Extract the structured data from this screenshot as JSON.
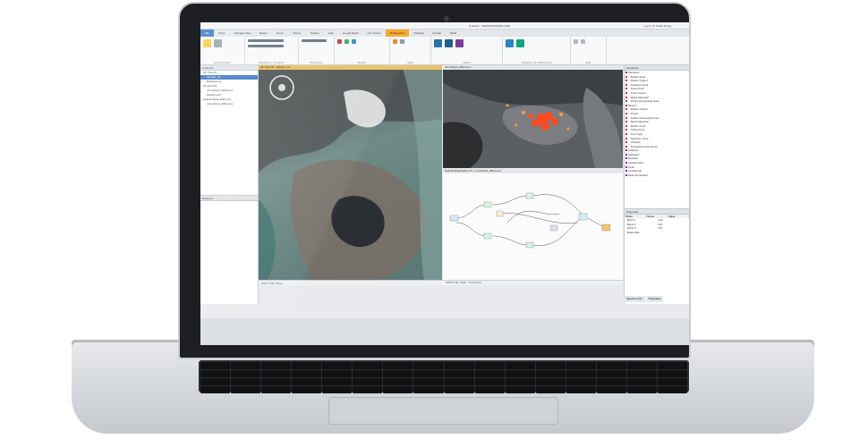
{
  "app": {
    "title": "Untitled1 - ERDAS IMAGINE 2018",
    "user": "Log in To Smart M.App"
  },
  "tabs": [
    {
      "label": "File"
    },
    {
      "label": "Home"
    },
    {
      "label": "Manage Data"
    },
    {
      "label": "Raster"
    },
    {
      "label": "Vector"
    },
    {
      "label": "Terrain"
    },
    {
      "label": "Toolbox"
    },
    {
      "label": "Help"
    },
    {
      "label": "Google Earth"
    },
    {
      "label": "UV Vectors"
    },
    {
      "label": "Multispectral"
    },
    {
      "label": "Drawing"
    },
    {
      "label": "Format"
    },
    {
      "label": "Table"
    }
  ],
  "context_tab": "Raster",
  "ribbon_groups": [
    {
      "label": "Enhancement"
    },
    {
      "label": "Brightness / Contrast"
    },
    {
      "label": "Sharpness"
    },
    {
      "label": "Bands"
    },
    {
      "label": "View"
    },
    {
      "label": "Utilities"
    },
    {
      "label": "Transform & Orthocorrect"
    },
    {
      "label": "Edit"
    }
  ],
  "contents": {
    "title": "Contents",
    "items": [
      {
        "label": "2D View #1"
      },
      {
        "label": "deurpel_12..."
      },
      {
        "label": "Background"
      },
      {
        "label": "2D View #2"
      },
      {
        "label": "normalized_difference"
      },
      {
        "label": "Background"
      },
      {
        "label": "Spatial Model Editor #1"
      },
      {
        "label": "normalized_difference"
      }
    ]
  },
  "retriever": {
    "title": "Retriever"
  },
  "views": {
    "left_title": "2D View #1 : deurpel_12...",
    "right_title": "normalized_difference",
    "model_title": "Spatial Model Editor #1 : normalized_difference"
  },
  "status": {
    "left": "479777.69, 6702...",
    "right": "479777.69, 6702... UTM Zone"
  },
  "operators": {
    "title": "Operators",
    "items": [
      {
        "label": "Favorites",
        "cat": true
      },
      {
        "label": "Raster Input"
      },
      {
        "label": "Raster Output"
      },
      {
        "label": "Features Input"
      },
      {
        "label": "Point Input"
      },
      {
        "label": "Point Output"
      },
      {
        "label": "Band Selection"
      },
      {
        "label": "Define Processing Area"
      },
      {
        "label": "Recent",
        "cat": true
      },
      {
        "label": "Raster Output"
      },
      {
        "label": "Pixels"
      },
      {
        "label": "Define Processing Area"
      },
      {
        "label": "Band Selection"
      },
      {
        "label": "Raster Input"
      },
      {
        "label": "String Input"
      },
      {
        "label": "Port Input"
      },
      {
        "label": "Directory Input"
      },
      {
        "label": "Preview"
      },
      {
        "label": "Principal Components"
      },
      {
        "label": "Analysis",
        "cat": true
      },
      {
        "label": "Attributes",
        "cat": true
      },
      {
        "label": "Boolean",
        "cat": true
      },
      {
        "label": "Classification",
        "cat": true
      },
      {
        "label": "Color",
        "cat": true
      },
      {
        "label": "Conditional",
        "cat": true
      },
      {
        "label": "Data Generation",
        "cat": true
      }
    ]
  },
  "properties": {
    "title": "Properties",
    "headers": [
      "Share",
      "Name",
      "Value"
    ],
    "rows": [
      {
        "name": "Band 1",
        "value": "N/A"
      },
      {
        "name": "Band 2",
        "value": "N/A"
      },
      {
        "name": "Band 3",
        "value": "N/A"
      },
      {
        "name": "RasterFile...",
        "value": ""
      }
    ]
  },
  "bottom_tabs": [
    {
      "label": "Operator Info"
    },
    {
      "label": "Properties"
    }
  ]
}
